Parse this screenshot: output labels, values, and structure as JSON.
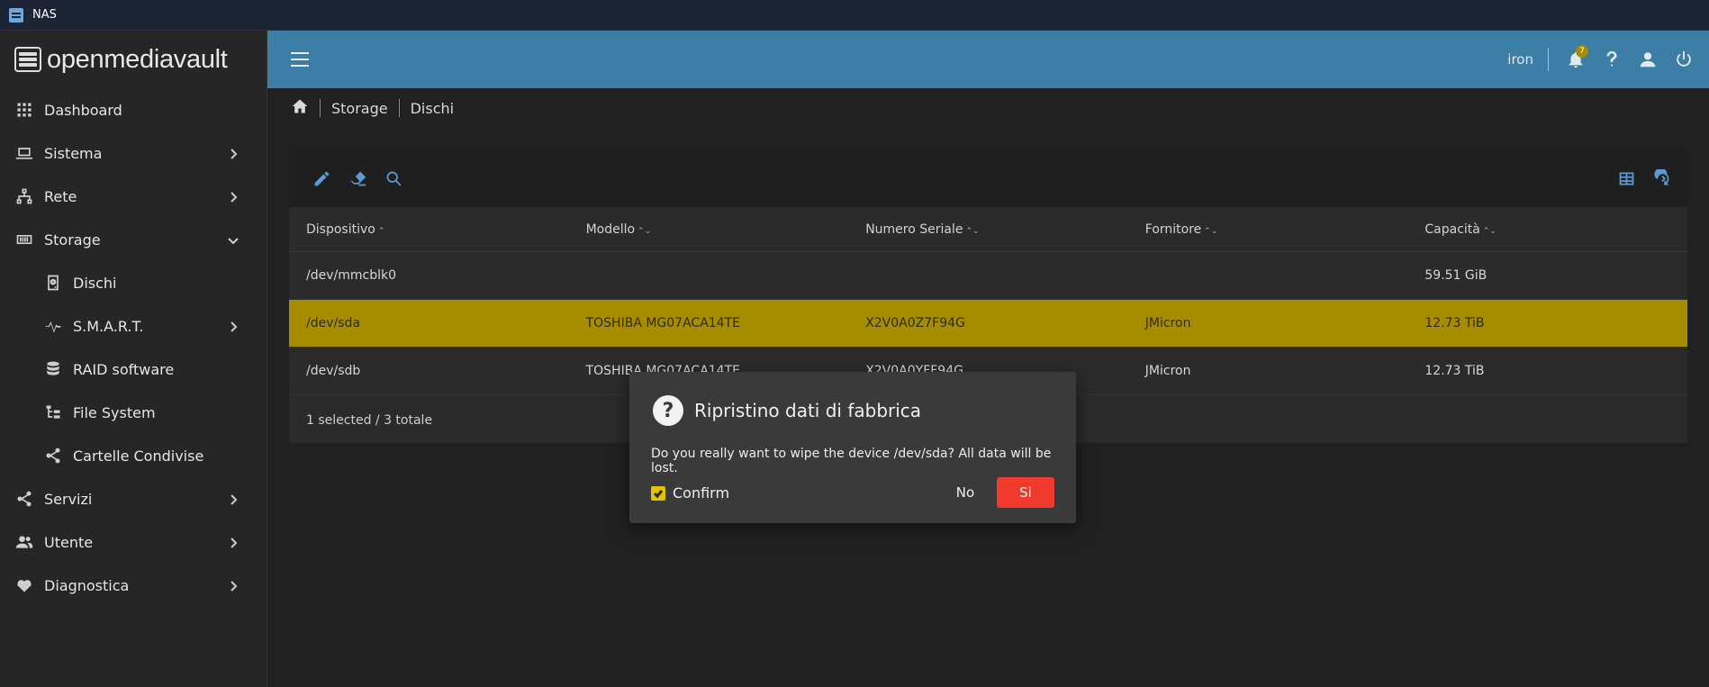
{
  "window": {
    "title": "NAS"
  },
  "brand": {
    "name": "openmediavault"
  },
  "sidebar": {
    "items": [
      {
        "label": "Dashboard"
      },
      {
        "label": "Sistema"
      },
      {
        "label": "Rete"
      },
      {
        "label": "Storage"
      },
      {
        "label": "Dischi"
      },
      {
        "label": "S.M.A.R.T."
      },
      {
        "label": "RAID software"
      },
      {
        "label": "File System"
      },
      {
        "label": "Cartelle Condivise"
      },
      {
        "label": "Servizi"
      },
      {
        "label": "Utente"
      },
      {
        "label": "Diagnostica"
      }
    ]
  },
  "header": {
    "user": "iron",
    "notification_count": "7"
  },
  "breadcrumb": {
    "items": [
      "Storage",
      "Dischi"
    ]
  },
  "table": {
    "columns": [
      "Dispositivo",
      "Modello",
      "Numero Seriale",
      "Fornitore",
      "Capacità"
    ],
    "sort_asc": "⌃",
    "sort_both": "⌃⌄",
    "rows": [
      {
        "device": "/dev/mmcblk0",
        "model": "",
        "serial": "",
        "vendor": "",
        "capacity": "59.51 GiB"
      },
      {
        "device": "/dev/sda",
        "model": "TOSHIBA MG07ACA14TE",
        "serial": "X2V0A0Z7F94G",
        "vendor": "JMicron",
        "capacity": "12.73 TiB"
      },
      {
        "device": "/dev/sdb",
        "model": "TOSHIBA MG07ACA14TE",
        "serial": "X2V0A0YFF94G",
        "vendor": "JMicron",
        "capacity": "12.73 TiB"
      }
    ],
    "footer": "1 selected / 3 totale"
  },
  "dialog": {
    "title": "Ripristino dati di fabbrica",
    "message": "Do you really want to wipe the device /dev/sda? All data will be lost.",
    "confirm_label": "Confirm",
    "confirm_checked": true,
    "no_label": "No",
    "yes_label": "Si"
  },
  "colors": {
    "header": "#3d7ea6",
    "selected_row": "#a88c00",
    "accent_icon": "#5b9bd5",
    "danger_button": "#f03a2e",
    "checkbox": "#e4c200"
  }
}
